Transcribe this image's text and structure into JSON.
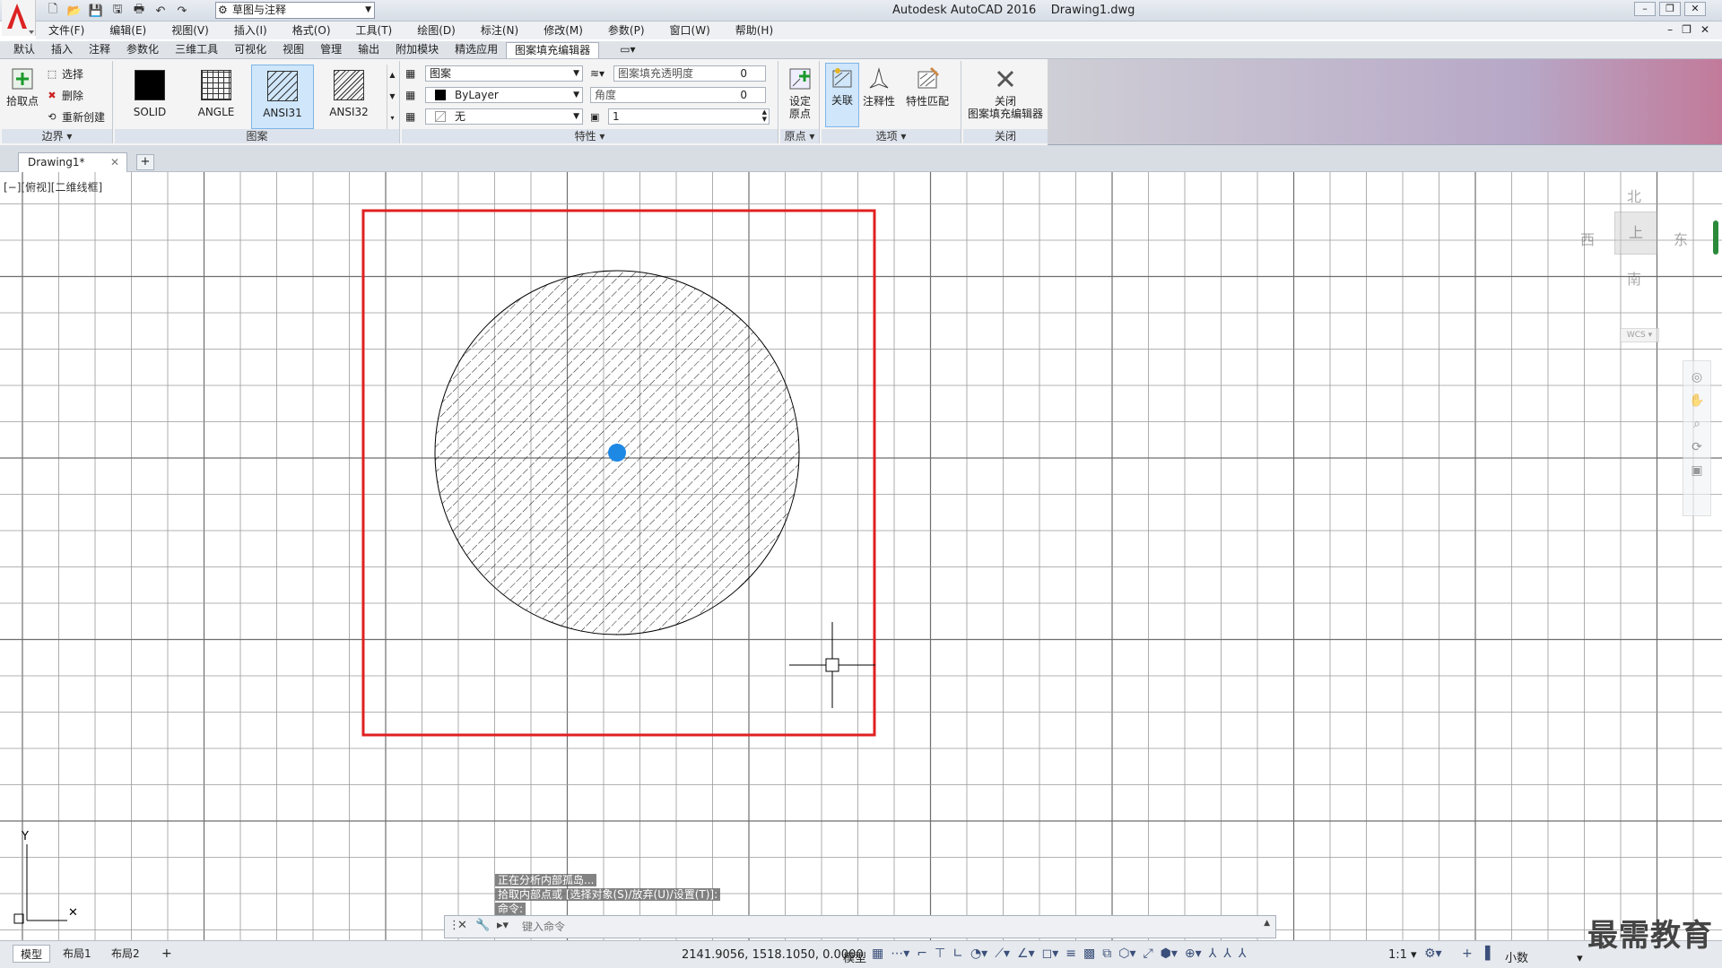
{
  "window": {
    "app_title": "Autodesk AutoCAD 2016",
    "file_title": "Drawing1.dwg",
    "workspace": "草图与注释"
  },
  "menu": [
    "文件(F)",
    "编辑(E)",
    "视图(V)",
    "插入(I)",
    "格式(O)",
    "工具(T)",
    "绘图(D)",
    "标注(N)",
    "修改(M)",
    "参数(P)",
    "窗口(W)",
    "帮助(H)"
  ],
  "ribbon_tabs": [
    "默认",
    "插入",
    "注释",
    "参数化",
    "三维工具",
    "可视化",
    "视图",
    "管理",
    "输出",
    "附加模块",
    "精选应用",
    "图案填充编辑器"
  ],
  "ribbon": {
    "boundary": {
      "title": "边界",
      "pick_point": "拾取点",
      "select": "选择",
      "remove": "删除",
      "recreate": "重新创建"
    },
    "pattern": {
      "title": "图案",
      "items": [
        "SOLID",
        "ANGLE",
        "ANSI31",
        "ANSI32"
      ],
      "selected": "ANSI31"
    },
    "properties": {
      "title": "特性",
      "type": "图案",
      "color": "ByLayer",
      "background": "无",
      "transparency_label": "图案填充透明度",
      "transparency_value": "0",
      "angle_label": "角度",
      "angle_value": "0",
      "scale_value": "1"
    },
    "origin": {
      "title": "原点",
      "set_origin_line1": "设定",
      "set_origin_line2": "原点"
    },
    "options": {
      "title": "选项",
      "associative": "关联",
      "annotative": "注释性",
      "match_properties": "特性匹配"
    },
    "close": {
      "title": "关闭",
      "line1": "关闭",
      "line2": "图案填充编辑器"
    }
  },
  "document": {
    "tab": "Drawing1*",
    "viewport_label": "[−][俯视][二维线框]"
  },
  "viewcube": {
    "north": "北",
    "south": "南",
    "east": "东",
    "west": "西",
    "top": "上",
    "wcs": "WCS"
  },
  "command": {
    "history": [
      "正在分析内部孤岛...",
      "拾取内部点或 [选择对象(S)/放弃(U)/设置(T)]:",
      "命令:"
    ],
    "placeholder": "键入命令"
  },
  "layouts": [
    "模型",
    "布局1",
    "布局2"
  ],
  "status": {
    "coords": "2141.9056, 1518.1050, 0.0000",
    "mode": "模型",
    "scale": "1:1",
    "units": "小数"
  },
  "watermark": "最需教育",
  "colors": {
    "selection_rect": "#e02020",
    "grip": "#1e88e5",
    "context_tab": "#c27a9a"
  }
}
